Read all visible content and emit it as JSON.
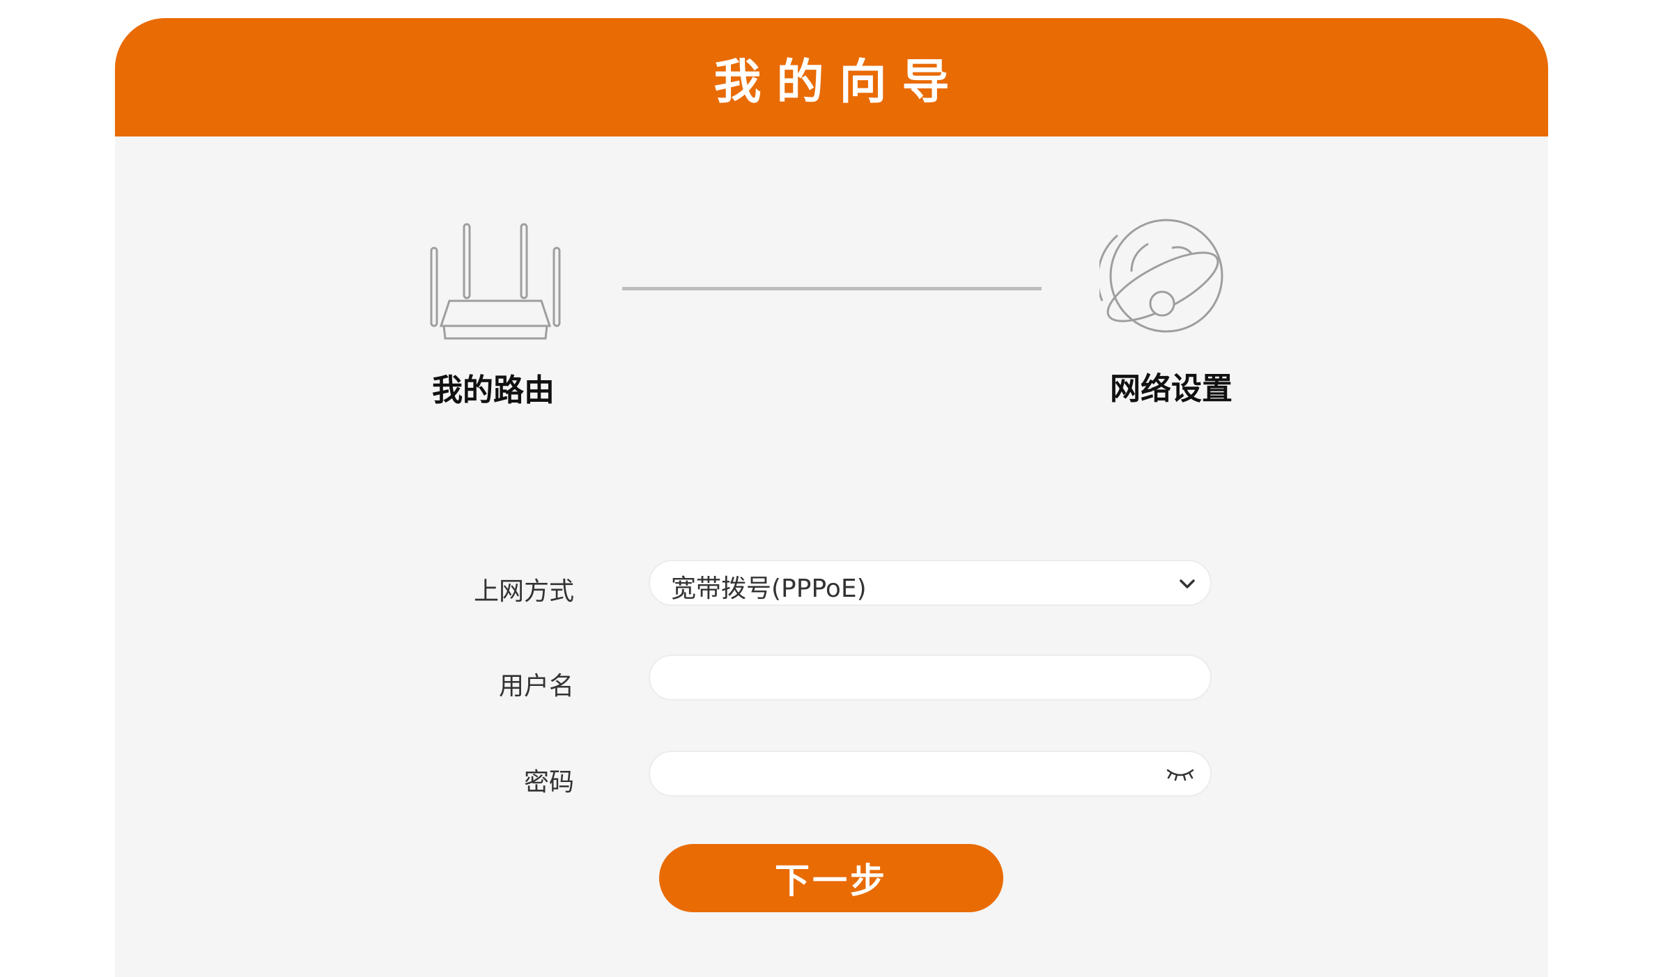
{
  "header": {
    "title": "我的向导"
  },
  "steps": {
    "router": {
      "label": "我的路由",
      "icon": "router-icon"
    },
    "network": {
      "label": "网络设置",
      "icon": "globe-icon"
    }
  },
  "form": {
    "connection_mode": {
      "label": "上网方式",
      "selected": "宽带拨号(PPPoE)"
    },
    "username": {
      "label": "用户名",
      "value": ""
    },
    "password": {
      "label": "密码",
      "value": ""
    }
  },
  "next_button": {
    "label": "下一步"
  },
  "colors": {
    "accent": "#e96b04",
    "body_background": "#f5f5f5"
  }
}
